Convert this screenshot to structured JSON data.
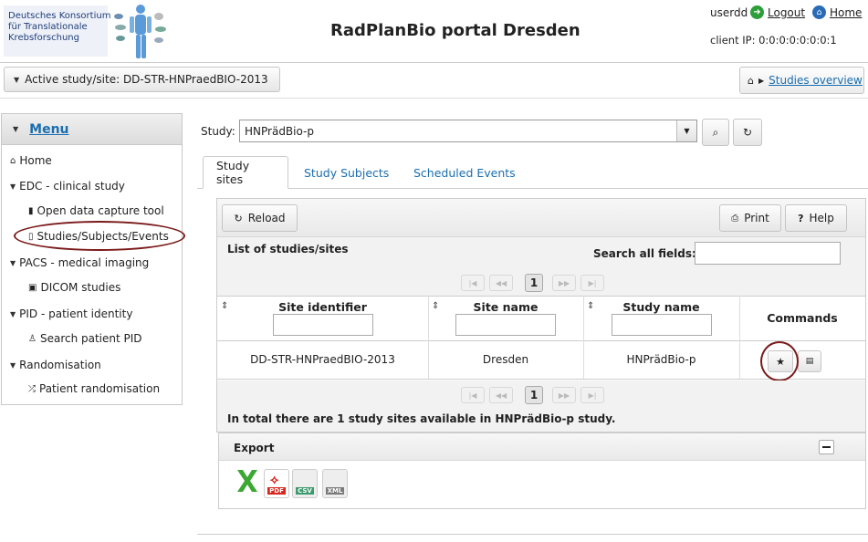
{
  "logo": {
    "line1": "Deutsches Konsortium",
    "line2": "für Translationale",
    "line3": "Krebsforschung"
  },
  "header": {
    "title": "RadPlanBio portal Dresden",
    "username": "userdd",
    "logout_label": "Logout",
    "home_label": "Home",
    "client_ip": "client IP: 0:0:0:0:0:0:0:1"
  },
  "active_study": {
    "label": "Active study/site: DD-STR-HNPraedBIO-2013"
  },
  "breadcrumb": {
    "link": "Studies overview"
  },
  "menu": {
    "title": "Menu",
    "items": [
      {
        "label": "Home"
      },
      {
        "label": "EDC - clinical study"
      },
      {
        "label": "Open data capture tool"
      },
      {
        "label": "Studies/Subjects/Events"
      },
      {
        "label": "PACS - medical imaging"
      },
      {
        "label": "DICOM studies"
      },
      {
        "label": "PID - patient identity"
      },
      {
        "label": "Search patient PID"
      },
      {
        "label": "Randomisation"
      },
      {
        "label": "Patient randomisation"
      }
    ]
  },
  "study_select": {
    "label": "Study:",
    "value": "HNPrädBio-p"
  },
  "tabs": [
    {
      "label": "Study sites"
    },
    {
      "label": "Study Subjects"
    },
    {
      "label": "Scheduled Events"
    }
  ],
  "toolbar": {
    "reload": "Reload",
    "print": "Print",
    "help": "Help"
  },
  "table": {
    "caption": "List of studies/sites",
    "search_label": "Search all fields:",
    "current_page": "1",
    "columns": [
      "Site identifier",
      "Site name",
      "Study name",
      "Commands"
    ],
    "rows": [
      {
        "site_identifier": "DD-STR-HNPraedBIO-2013",
        "site_name": "Dresden",
        "study_name": "HNPrädBio-p"
      }
    ],
    "footer": "In total there are 1 study sites available in HNPrädBio-p study."
  },
  "export": {
    "title": "Export",
    "formats": [
      "XLS",
      "PDF",
      "CSV",
      "XML"
    ]
  },
  "colors": {
    "link": "#1a6eb0",
    "highlight_ring": "#7a1a1a"
  }
}
